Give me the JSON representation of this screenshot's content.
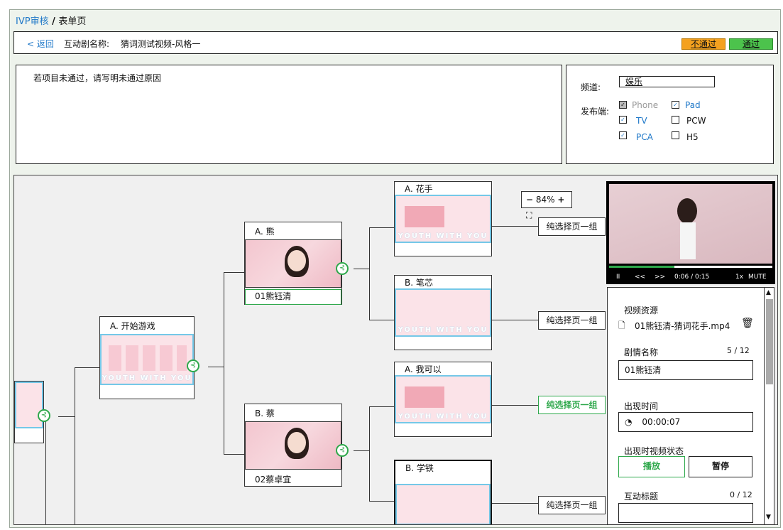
{
  "breadcrumb": {
    "root": "IVP审核",
    "sep": " / ",
    "current": "表单页"
  },
  "header": {
    "back": "< 返回",
    "name_label": "互动剧名称:",
    "name_value": "猜词测试视频-风格一",
    "reject": "不通过",
    "approve": "通过",
    "reject_color": "#f4a11f",
    "approve_color": "#4cc34c"
  },
  "reason": {
    "placeholder": "若项目未通过，请写明未通过原因"
  },
  "channel": {
    "label": "频道:",
    "value": "娱乐",
    "platform_label": "发布端:",
    "platforms": [
      {
        "name": "Phone",
        "checked": true,
        "disabled": true
      },
      {
        "name": "Pad",
        "checked": true
      },
      {
        "name": "TV",
        "checked": true
      },
      {
        "name": "PCW",
        "checked": false
      },
      {
        "name": "PCA",
        "checked": true
      },
      {
        "name": "H5",
        "checked": false
      }
    ]
  },
  "zoom": {
    "minus": "−",
    "value": "84%",
    "plus": "+",
    "fit_icon": "fit-screen-icon"
  },
  "nodes": {
    "start": {
      "title": "A. 开始游戏"
    },
    "bear": {
      "title": "A. 熊",
      "caption": "01熊钰清"
    },
    "cai": {
      "title": "B. 蔡",
      "caption": "02蔡卓宜"
    },
    "huashou": {
      "title": "A. 花手"
    },
    "bixin": {
      "title": "B. 笔芯"
    },
    "wokeyi": {
      "title": "A. 我可以"
    },
    "xuetie": {
      "title": "B. 学铁"
    },
    "thumb_text": "YOUTH WITH YOU"
  },
  "choice_groups": [
    "纯选择页一组",
    "纯选择页一组",
    "纯选择页一组",
    "纯选择页一组"
  ],
  "player": {
    "pause": "II",
    "rewind": "<<",
    "forward": ">>",
    "time": "0:06 / 0:15",
    "speed": "1x",
    "mute": "MUTE",
    "progress": 0.4
  },
  "panel": {
    "video_label": "视频资源",
    "video_file": "01熊钰清-猜词花手.mp4",
    "plot_label": "剧情名称",
    "plot_count": "5 / 12",
    "plot_value": "01熊钰清",
    "time_label": "出现时间",
    "time_value": "00:00:07",
    "state_label": "出现时视频状态",
    "play": "播放",
    "pause": "暂停",
    "title_label": "互动标题",
    "title_count": "0 / 12"
  }
}
